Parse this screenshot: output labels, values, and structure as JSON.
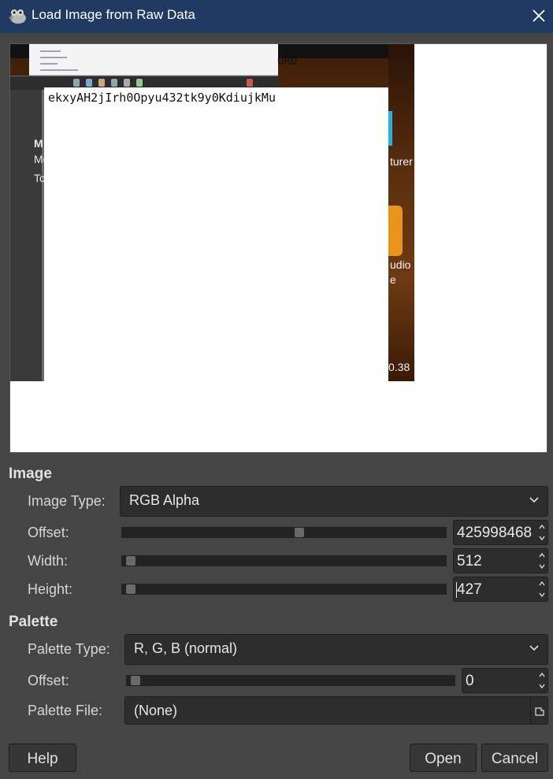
{
  "window": {
    "title": "Load Image from Raw Data"
  },
  "preview": {
    "text_top": "ORD",
    "text_main": "ekxyAH2jIrh0Opyu432tk9y0KdiujkMu",
    "left_panel_texts": [
      "M",
      "Mo",
      "To"
    ],
    "right_side_texts": [
      "turer",
      "udio",
      "e",
      "0.38"
    ]
  },
  "image_section": {
    "title": "Image",
    "image_type_label": "Image Type:",
    "image_type_value": "RGB Alpha",
    "offset_label": "Offset:",
    "offset_value": "425998468",
    "offset_fraction": 0.55,
    "width_label": "Width:",
    "width_value": "512",
    "width_fraction": 0.0,
    "height_label": "Height:",
    "height_value": "427",
    "height_fraction": 0.0
  },
  "palette_section": {
    "title": "Palette",
    "palette_type_label": "Palette Type:",
    "palette_type_value": "R, G, B (normal)",
    "offset_label": "Offset:",
    "offset_value": "0",
    "offset_fraction": 0.0,
    "palette_file_label": "Palette File:",
    "palette_file_value": "(None)"
  },
  "buttons": {
    "help": "Help",
    "open": "Open",
    "cancel": "Cancel"
  },
  "colors": {
    "titlebar": "#213a61",
    "dialog_bg": "#454545",
    "field_bg": "#2d2d2d"
  },
  "icons": {
    "app": "gimp-wilber-icon",
    "close": "close-icon",
    "dropdown": "chevron-down-icon",
    "spin": "spin-arrows-icon",
    "file": "file-chooser-icon"
  }
}
